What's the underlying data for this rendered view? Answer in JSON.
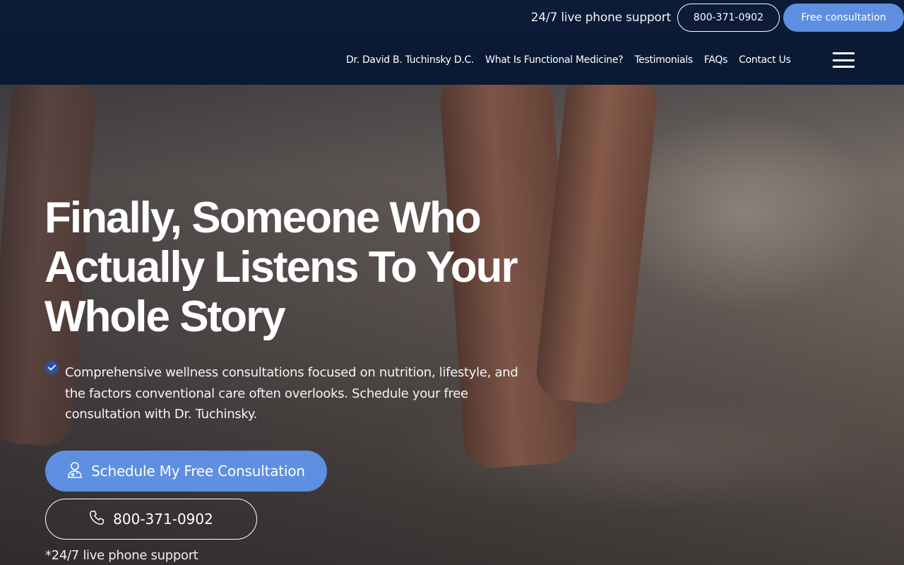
{
  "topbar": {
    "support_text": "24/7 live phone support",
    "phone": "800-371-0902",
    "consult_label": "Free consultation"
  },
  "nav": {
    "items": [
      {
        "label": "Dr. David B. Tuchinsky D.C."
      },
      {
        "label": "What Is Functional Medicine?"
      },
      {
        "label": "Testimonials"
      },
      {
        "label": "FAQs"
      },
      {
        "label": "Contact Us"
      }
    ],
    "menu_icon": "hamburger-icon"
  },
  "hero": {
    "headline": "Finally, Someone Who Actually Listens To Your Whole Story",
    "bullet_icon": "check-circle-icon",
    "description": "Comprehensive wellness consultations focused on nutrition, lifestyle, and the factors conventional care often overlooks. Schedule your free consultation with Dr. Tuchinsky.",
    "cta_primary": "Schedule My Free Consultation",
    "cta_primary_icon": "doctor-icon",
    "cta_phone": "800-371-0902",
    "cta_phone_icon": "phone-icon",
    "footnote": "*24/7 live phone support"
  },
  "colors": {
    "navy": "#0a1a35",
    "accent": "#5e8fe0",
    "check": "#2c4fa0"
  }
}
